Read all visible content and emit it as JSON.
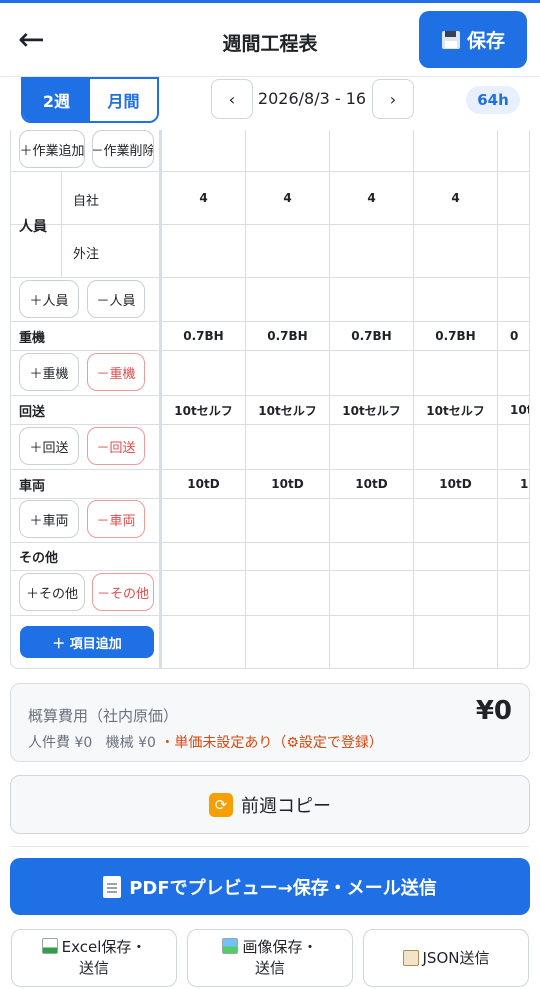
{
  "header": {
    "back_icon": "←",
    "title": "週間工程表",
    "save_label": "保存",
    "save_icon": "floppy-disk-icon"
  },
  "toolbar": {
    "view_2w": "2週",
    "view_month": "月間",
    "active_view": "2週",
    "prev": "‹",
    "next": "›",
    "range": "2026/8/3 - 16",
    "hours": "64h"
  },
  "grid": {
    "top_actions": {
      "add_work": "＋作業追加",
      "remove_work": "－作業削除"
    },
    "personnel": {
      "label": "人員",
      "own_label": "自社",
      "outsourced_label": "外注",
      "own_values": [
        "4",
        "4",
        "4",
        "4",
        ""
      ],
      "add": "＋人員",
      "remove": "－人員"
    },
    "heavy_machinery": {
      "label": "重機",
      "values": [
        "0.7BH",
        "0.7BH",
        "0.7BH",
        "0.7BH",
        "0"
      ],
      "add": "＋重機",
      "remove": "－重機"
    },
    "transport": {
      "label": "回送",
      "values": [
        "10tセルフ",
        "10tセルフ",
        "10tセルフ",
        "10tセルフ",
        "10t"
      ],
      "add": "＋回送",
      "remove": "－回送"
    },
    "vehicles": {
      "label": "車両",
      "values": [
        "10tD",
        "10tD",
        "10tD",
        "10tD",
        "1"
      ],
      "add": "＋車両",
      "remove": "－車両"
    },
    "others": {
      "label": "その他",
      "add": "＋その他",
      "remove": "－その他"
    },
    "add_item": "＋ 項目追加"
  },
  "cost": {
    "title": "概算費用（社内原価）",
    "total": "¥0",
    "labor": "人件費 ¥0",
    "machine": "機械 ¥0",
    "warning": "・単価未設定あり（⚙設定で登録）"
  },
  "actions": {
    "copy_prev_week": "前週コピー",
    "pdf_preview": "PDFでプレビュー→保存・メール送信",
    "excel": "Excel保存・\n送信",
    "excel_line1": "Excel保存・",
    "excel_line2": "送信",
    "image_line1": "画像保存・",
    "image_line2": "送信",
    "json": "JSON送信"
  },
  "colors": {
    "accent": "#1f6fe5",
    "warning": "#d9480f",
    "danger": "#e24b4b"
  }
}
